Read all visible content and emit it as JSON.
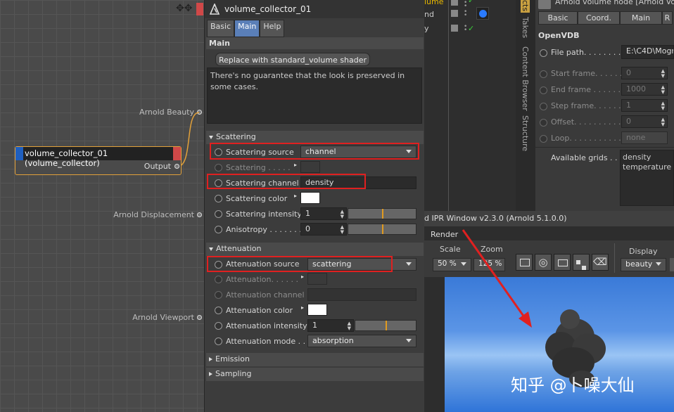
{
  "node_graph": {
    "inputs": [
      {
        "label": "Arnold Beauty"
      },
      {
        "label": "Arnold Displacement"
      },
      {
        "label": "Arnold Viewport"
      }
    ],
    "node": {
      "title": "volume_collector_01 (volume_collector)",
      "output_label": "Output"
    }
  },
  "panel": {
    "title": "volume_collector_01",
    "tabs": [
      {
        "label": "Basic"
      },
      {
        "label": "Main"
      },
      {
        "label": "Help"
      }
    ],
    "active_tab": "Main",
    "main_header": "Main",
    "replace_button": "Replace with standard_volume shader",
    "note": "There's no guarantee that the look is preserved in some cases.",
    "scattering": {
      "header": "Scattering",
      "source_label": "Scattering source",
      "source_value": "channel",
      "scattering_label": "Scattering . . . . .",
      "channel_label": "Scattering channel",
      "channel_value": "density",
      "color_label": "Scattering color",
      "intensity_label": "Scattering intensity",
      "intensity_value": "1",
      "intensity_level": 0.5,
      "anisotropy_label": "Anisotropy . . . . . . .",
      "anisotropy_value": "0",
      "anisotropy_level": 0.5
    },
    "attenuation": {
      "header": "Attenuation",
      "source_label": "Attenuation source",
      "source_value": "scattering",
      "attenuation_label": "Attenuation. . . . . .",
      "channel_label": "Attenuation channel",
      "color_label": "Attenuation color",
      "intensity_label": "Attenuation intensity",
      "intensity_value": "1",
      "intensity_level": 0.5,
      "mode_label": "Attenuation mode . .",
      "mode_value": "absorption"
    },
    "emission_header": "Emission",
    "sampling_header": "Sampling"
  },
  "object_manager": {
    "rows": [
      {
        "label": "lume"
      },
      {
        "label": "nd"
      },
      {
        "label": "y"
      }
    ]
  },
  "side_tabs": [
    {
      "label": "cts"
    },
    {
      "label": "Takes"
    },
    {
      "label": "Content Browser"
    },
    {
      "label": "Structure"
    }
  ],
  "attributes": {
    "title": "Arnold volume node [Arnold Vo",
    "tabs": [
      {
        "label": "Basic"
      },
      {
        "label": "Coord."
      },
      {
        "label": "Main"
      },
      {
        "label": "R"
      }
    ],
    "section": "OpenVDB",
    "file_path_label": "File path. . . . . . . . .",
    "file_path_value": "E:\\C4D\\Mogr",
    "start_frame_label": "Start frame. . . . . . .",
    "start_frame_value": "0",
    "end_frame_label": "End frame . . . . . . .",
    "end_frame_value": "1000",
    "step_frame_label": "Step frame. . . . . . .",
    "step_frame_value": "1",
    "offset_label": "Offset. . . . . . . . . . .",
    "offset_value": "0",
    "loop_label": "Loop. . . . . . . . . . . .",
    "loop_value": "none",
    "grids_label": "Available grids . . .",
    "grids": [
      "density",
      "temperature"
    ]
  },
  "ipr": {
    "title": "d IPR Window v2.3.0 (Arnold 5.1.0.0)",
    "menu": "Render",
    "scale_label": "Scale",
    "scale_value": "50 %",
    "zoom_label": "Zoom",
    "zoom_value": "125 %",
    "display_label": "Display",
    "display_value": "beauty",
    "watermark": "知乎 @卜噪大仙"
  },
  "colors": {
    "accent_blue": "#5a7fb8",
    "highlight_red": "#e02020",
    "node_border": "#e2a13a",
    "slider_knob": "#e09a20"
  }
}
